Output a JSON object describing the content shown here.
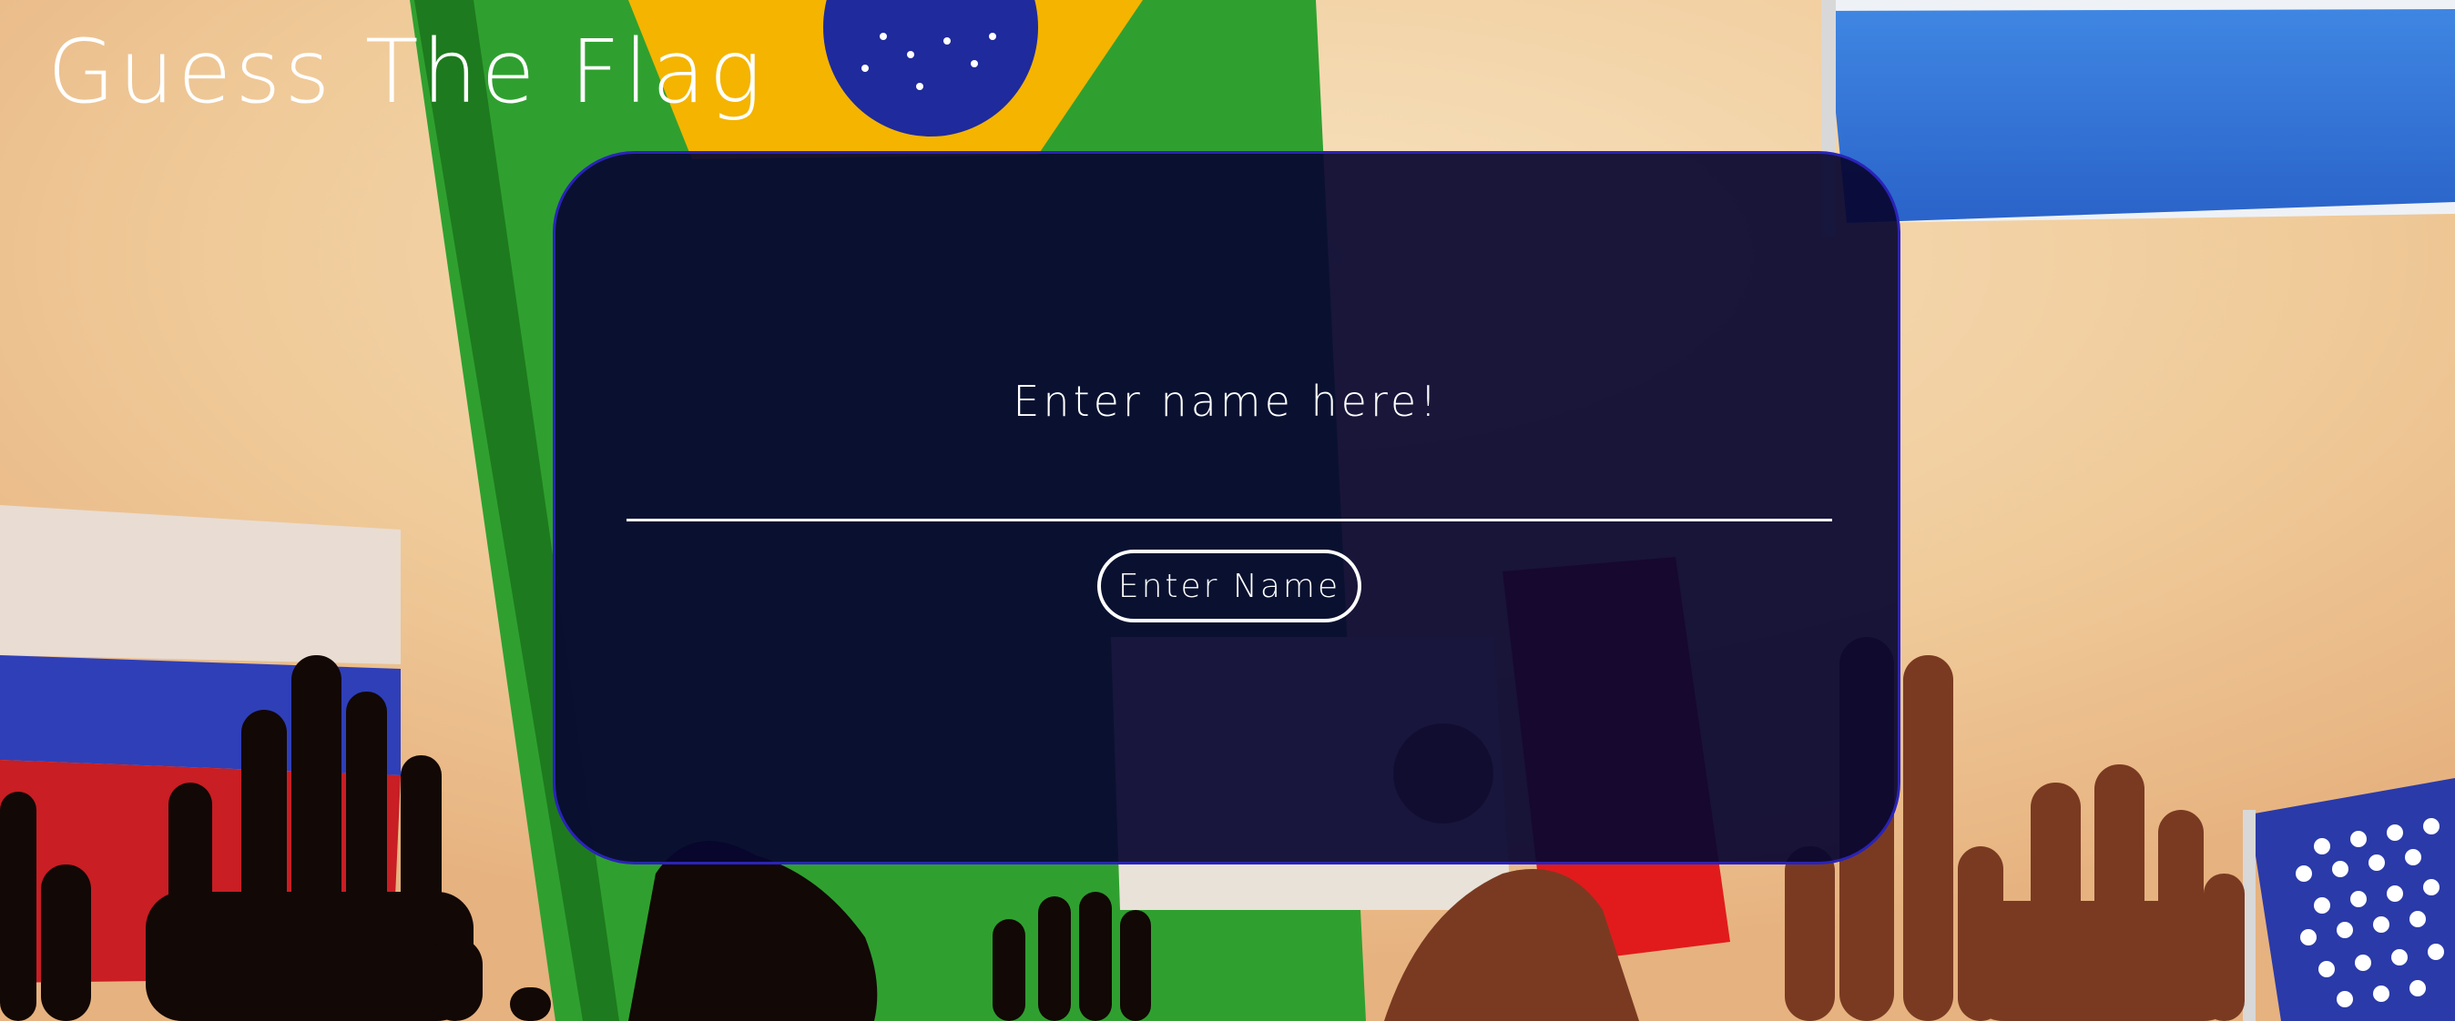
{
  "header": {
    "title": "Guess The Flag"
  },
  "name_form": {
    "prompt": "Enter name here!",
    "input_value": "",
    "submit_label": "Enter Name"
  },
  "colors": {
    "card_background": "#080630",
    "card_border": "#2a23b8",
    "text": "#ffffff"
  },
  "background": {
    "icons": [
      "brazil-flag-icon",
      "argentina-flag-icon",
      "russia-flag-icon",
      "usa-flag-icon",
      "mexico-flag-icon",
      "red-flag-icon"
    ]
  }
}
